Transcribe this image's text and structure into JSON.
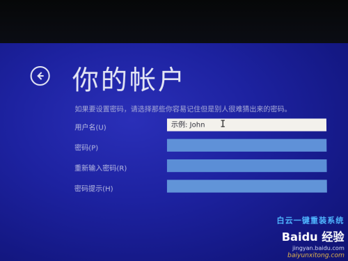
{
  "page": {
    "title": "你的帐户",
    "instruction": "如果要设置密码，请选择那些你容易记住但是别人很难猜出来的密码。"
  },
  "icons": {
    "back": "back-arrow-icon"
  },
  "form": {
    "username_label": "用户名(U)",
    "username_placeholder": "示例: John",
    "password_label": "密码(P)",
    "password_value": "",
    "reenter_label": "重新输入密码(R)",
    "reenter_value": "",
    "hint_label": "密码提示(H)",
    "hint_value": ""
  },
  "watermark": {
    "title": "白云一键重装系统",
    "logo": "Baidu 经验",
    "url": "jingyan.baidu.com",
    "site": "baiyunxitong.com"
  },
  "colors": {
    "screen_blue": "#1d22a0",
    "input_active": "#f3f1ec",
    "input_inactive": "#5f91d8",
    "title_text": "#e4e6f4"
  }
}
